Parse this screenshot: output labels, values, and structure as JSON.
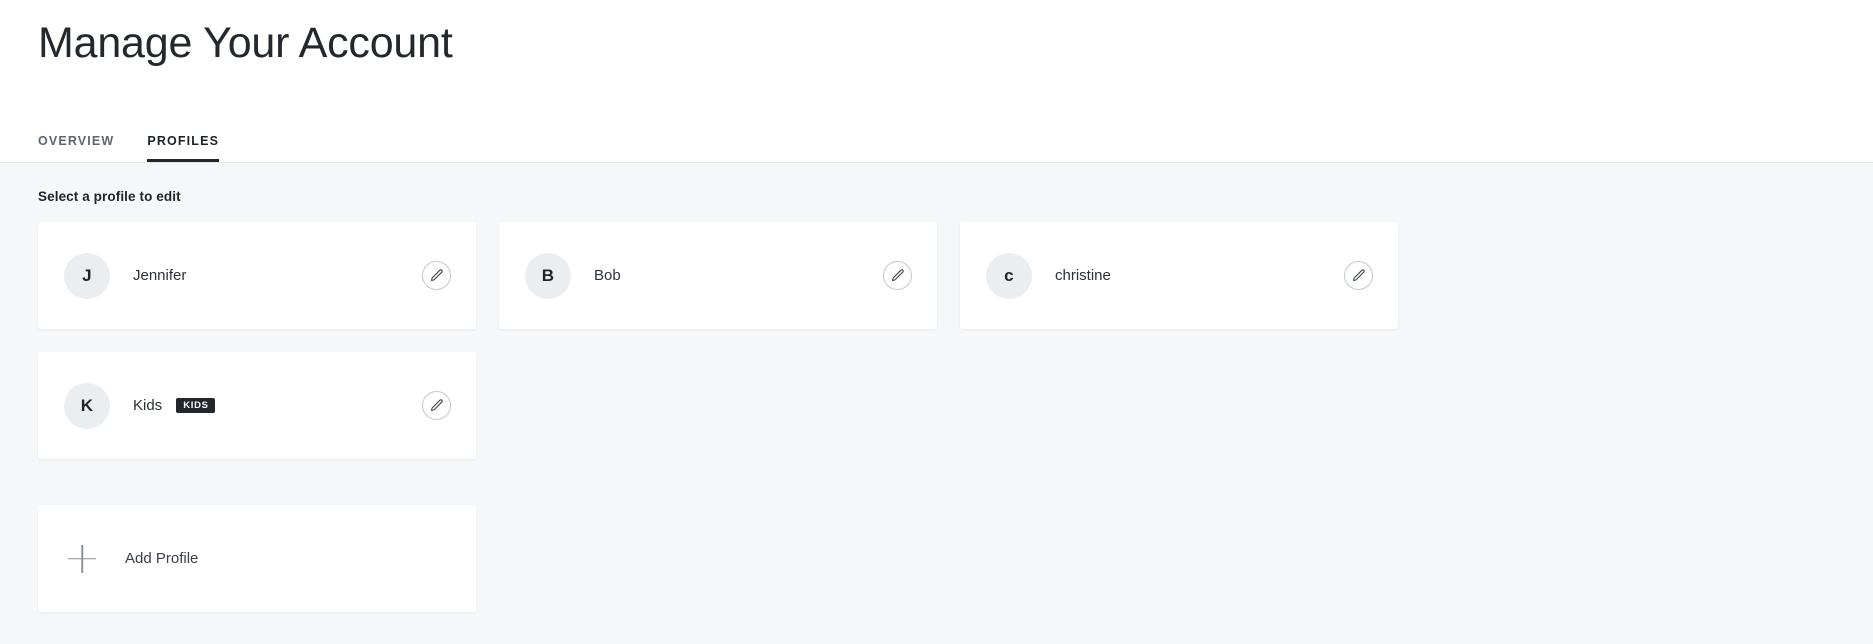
{
  "header": {
    "title": "Manage Your Account",
    "tabs": [
      {
        "label": "OVERVIEW",
        "active": false
      },
      {
        "label": "PROFILES",
        "active": true
      }
    ]
  },
  "main": {
    "section_label": "Select a profile to edit",
    "profiles": [
      {
        "initial": "J",
        "name": "Jennifer",
        "badge": "",
        "edit_icon": "pencil-icon"
      },
      {
        "initial": "B",
        "name": "Bob",
        "badge": "",
        "edit_icon": "pencil-icon"
      },
      {
        "initial": "c",
        "name": "christine",
        "badge": "",
        "edit_icon": "pencil-icon"
      },
      {
        "initial": "K",
        "name": "Kids",
        "badge": "KIDS",
        "edit_icon": "pencil-icon"
      }
    ],
    "add_profile": {
      "label": "Add Profile",
      "icon": "plus-icon"
    }
  },
  "colors": {
    "page_background": "#f5f7f9",
    "card_background": "#ffffff",
    "header_background": "#ffffff",
    "text_primary": "#21262c",
    "text_muted": "#5c6670",
    "avatar_background": "#ebeef1",
    "badge_background": "#22272e",
    "tab_indicator": "#22272c",
    "divider": "#e3e7ea"
  }
}
